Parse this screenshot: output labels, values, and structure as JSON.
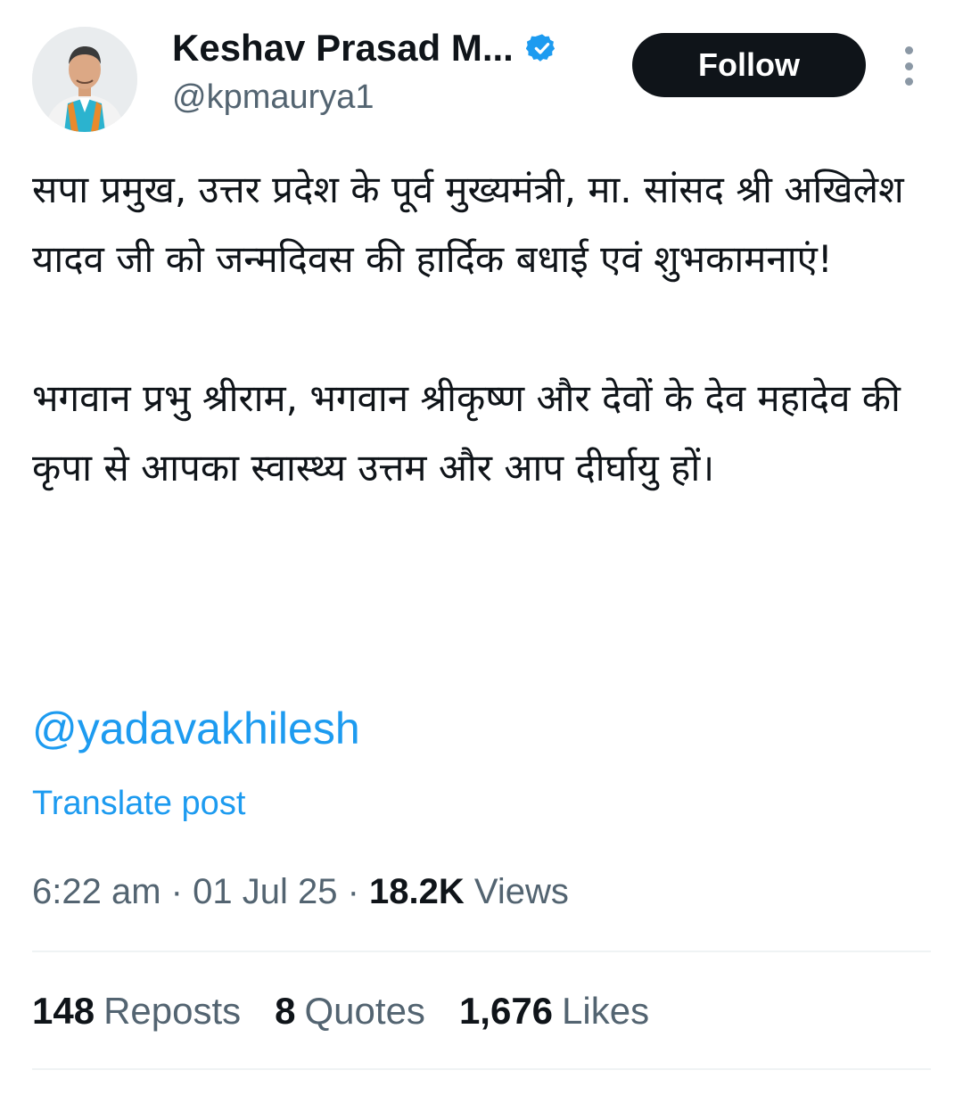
{
  "user": {
    "display_name": "Keshav Prasad M...",
    "handle": "@kpmaurya1",
    "verified_icon": "verified-badge-icon",
    "avatar": "profile-photo"
  },
  "actions": {
    "follow_label": "Follow",
    "more_icon": "more-vertical-icon"
  },
  "tweet": {
    "paragraph1": "सपा प्रमुख, उत्तर प्रदेश के पूर्व मुख्यमंत्री, मा. सांसद श्री अखिलेश यादव जी को जन्मदिवस की हार्दिक बधाई एवं शुभकामनाएं!",
    "paragraph2": "भगवान प्रभु श्रीराम, भगवान श्रीकृष्ण और देवों के देव महादेव की कृपा से आपका स्वास्थ्य उत्तम और आप दीर्घायु हों।",
    "mention": "@yadavakhilesh",
    "translate_label": "Translate post"
  },
  "meta": {
    "time": "6:22 am",
    "separator": "·",
    "date": "01 Jul 25",
    "views_count": "18.2K",
    "views_label": "Views"
  },
  "stats": {
    "reposts_count": "148",
    "reposts_label": "Reposts",
    "quotes_count": "8",
    "quotes_label": "Quotes",
    "likes_count": "1,676",
    "likes_label": "Likes"
  },
  "colors": {
    "link": "#1d9bf0",
    "text": "#0f1419",
    "secondary": "#536471",
    "button": "#0f1419",
    "vest": "#2bb3cf"
  }
}
